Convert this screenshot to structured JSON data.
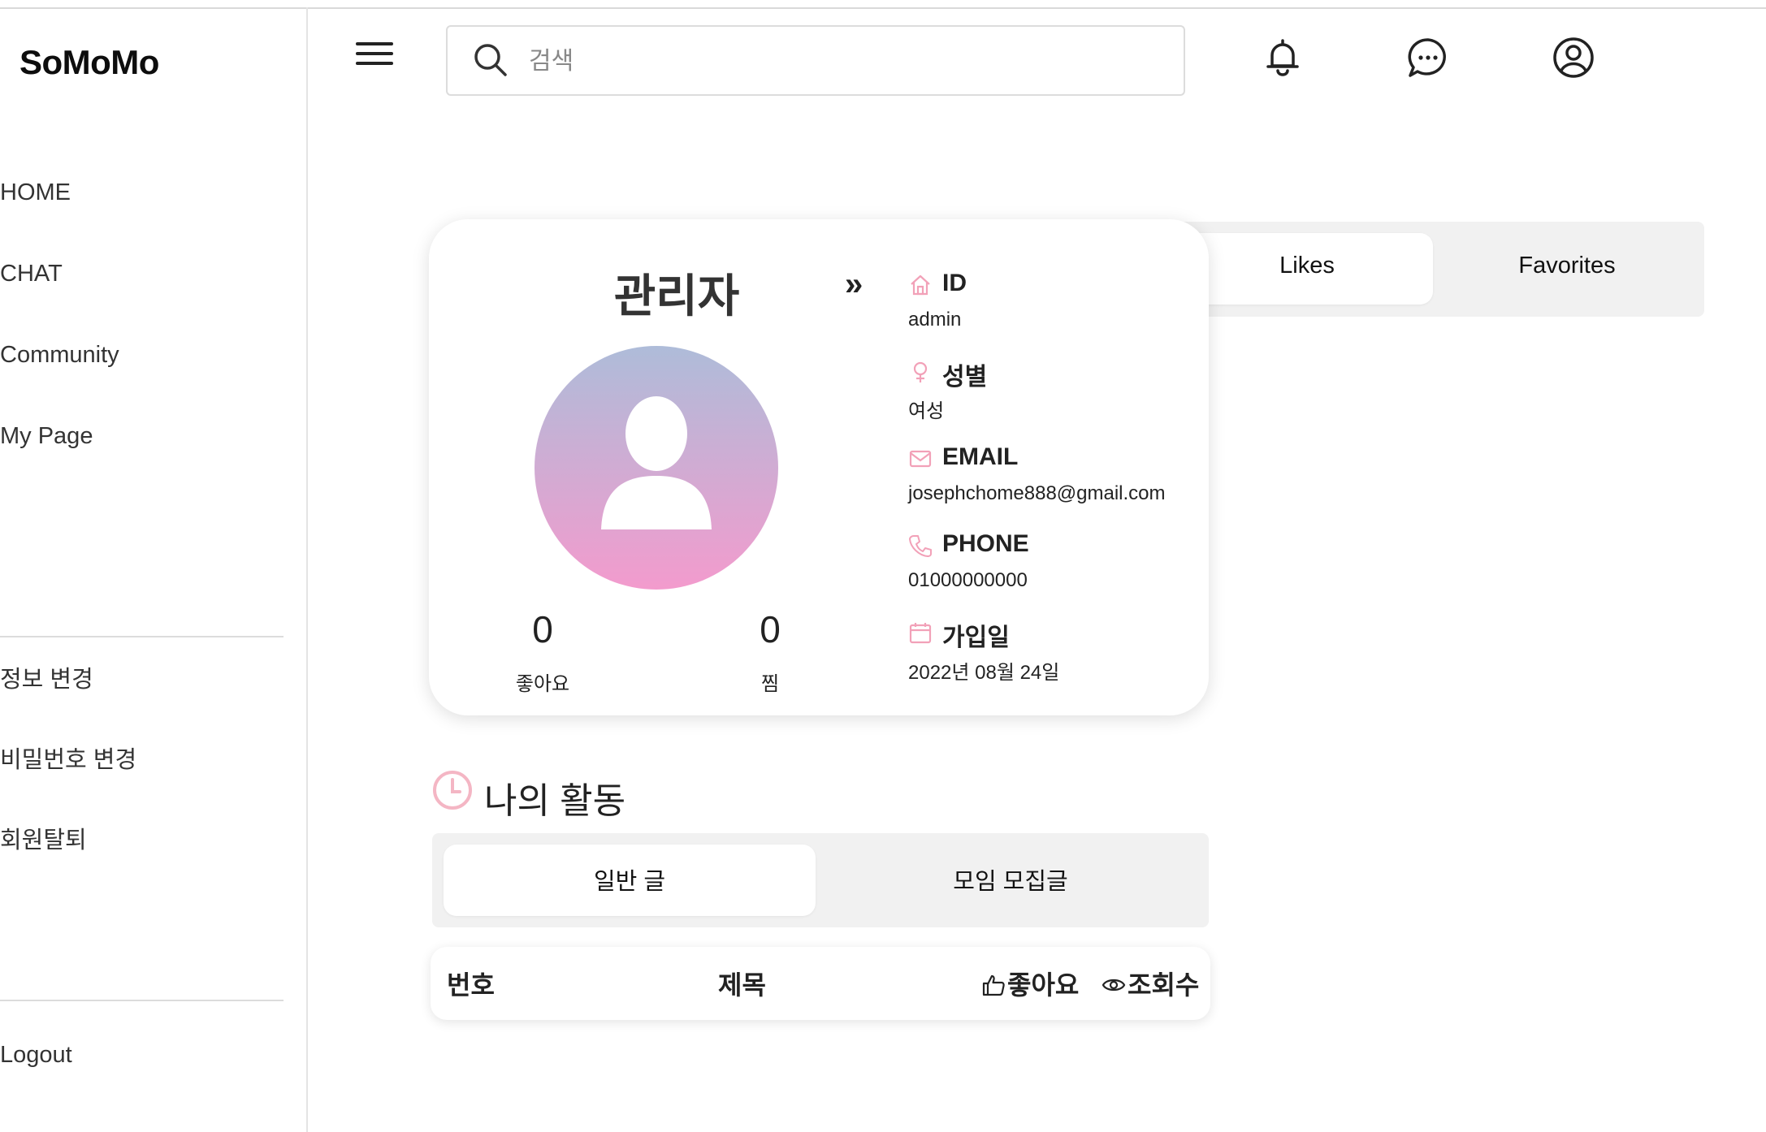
{
  "app": {
    "logo": "SoMoMo"
  },
  "sidebar": {
    "nav": [
      {
        "label": "HOME"
      },
      {
        "label": "CHAT"
      },
      {
        "label": "Community"
      },
      {
        "label": "My Page"
      }
    ],
    "settings": [
      {
        "label": "정보 변경"
      },
      {
        "label": "비밀번호 변경"
      },
      {
        "label": "회원탈퇴"
      }
    ],
    "logout": "Logout"
  },
  "header": {
    "search_placeholder": "검색",
    "icons": [
      "menu-icon",
      "search-icon",
      "bell-icon",
      "chat-bubble-icon",
      "user-circle-icon"
    ]
  },
  "profile": {
    "name": "관리자",
    "likes_count": "0",
    "likes_label": "좋아요",
    "favorites_count": "0",
    "favorites_label": "찜",
    "expand_glyph": "»",
    "fields": [
      {
        "label": "ID",
        "value": "admin",
        "icon": "home-icon"
      },
      {
        "label": "성별",
        "value": "여성",
        "icon": "female-icon"
      },
      {
        "label": "EMAIL",
        "value": "josephchome888@gmail.com",
        "icon": "mail-icon"
      },
      {
        "label": "PHONE",
        "value": "01000000000",
        "icon": "phone-icon"
      },
      {
        "label": "가입일",
        "value": "2022년 08월 24일",
        "icon": "calendar-icon"
      }
    ]
  },
  "right_tabs": {
    "likes": "Likes",
    "favorites": "Favorites",
    "selected": "Likes"
  },
  "activity": {
    "title": "나의 활동",
    "tabs": {
      "general": "일반 글",
      "meetup": "모임 모집글",
      "selected": "일반 글"
    },
    "columns": {
      "number": "번호",
      "title": "제목",
      "likes": "좋아요",
      "views": "조회수"
    }
  },
  "colors": {
    "accent_pink": "#f2a1b8",
    "avatar_top": "#aebcd9",
    "avatar_bottom": "#f39bcd",
    "tab_bg": "#f1f1f1"
  }
}
